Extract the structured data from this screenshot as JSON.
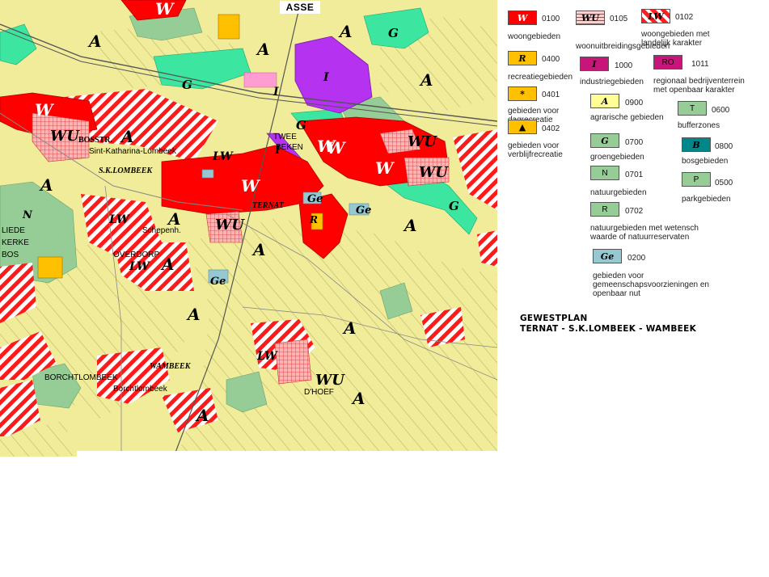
{
  "map": {
    "top_label": "ASSE",
    "zone_letters": [
      "A",
      "A",
      "A",
      "A",
      "A",
      "A",
      "A",
      "A",
      "A",
      "A",
      "A",
      "A",
      "A",
      "A",
      "G",
      "G",
      "G",
      "G",
      "I",
      "I",
      "I",
      "W",
      "W",
      "W",
      "W",
      "W",
      "WU",
      "WU",
      "WU",
      "WU",
      "WU",
      "LW",
      "LW",
      "LW",
      "LW",
      "Ge",
      "Ge",
      "Ge",
      "R",
      "N",
      "W"
    ],
    "place_names": {
      "bosstr": "BOSSTR.",
      "sk_lombeek": "S.K.LOMBEEK",
      "ternat": "TERNAT",
      "twee": "TWEE",
      "beken": "BEKEN",
      "liede": "LIEDE",
      "kerke": "KERKE",
      "bos": "BOS",
      "overdorp": "OVERDORP",
      "wambeek": "WAMBEEK",
      "borchtlombeek": "BORCHTLOMBEEK",
      "dhoef": "D'HOEF",
      "katharina": "Sint-Katharina-Lombeek",
      "schepenh": "Schepenh.",
      "borcht_small": "Borchtlombeek"
    }
  },
  "legend": [
    {
      "swatch": "W",
      "fill": "#ff0000",
      "code": "0100",
      "desc": [
        "woongebieden"
      ],
      "text_color": "#ffffff"
    },
    {
      "swatch": "WU",
      "fill": "#ff9c9c",
      "code": "0105",
      "desc": [
        "woonuitbreidingsgebieden"
      ],
      "hatch": "grid"
    },
    {
      "swatch": "LW",
      "fill": "#ff2020",
      "code": "0102",
      "desc": [
        "woongebieden met",
        "landelijk karakter"
      ],
      "hatch": "diag"
    },
    {
      "swatch": "R",
      "fill": "#ffc000",
      "code": "0400",
      "desc": [
        "recreatiegebieden"
      ]
    },
    {
      "swatch": "I",
      "fill": "#c8157a",
      "code": "1000",
      "desc": [
        "industriegebieden"
      ]
    },
    {
      "swatch": "RO",
      "fill": "#c8157a",
      "code": "1011",
      "desc": [
        "regionaal bedrijventerrein",
        "met openbaar   karakter"
      ]
    },
    {
      "swatch": "*",
      "fill": "#ffc000",
      "code": "0401",
      "desc": [
        "gebieden voor",
        "dagrecreatie"
      ]
    },
    {
      "swatch": "A",
      "fill": "#ffff96",
      "code": "0900",
      "desc": [
        "agrarische gebieden"
      ]
    },
    {
      "swatch": "T",
      "fill": "#96cd96",
      "code": "0600",
      "desc": [
        "bufferzones"
      ]
    },
    {
      "swatch": "▲",
      "fill": "#ffc000",
      "code": "0402",
      "desc": [
        "gebieden voor",
        "verblijfrecreatie"
      ]
    },
    {
      "swatch": "G",
      "fill": "#96cd96",
      "code": "0700",
      "desc": [
        "groengebieden"
      ]
    },
    {
      "swatch": "B",
      "fill": "#00878a",
      "code": "0800",
      "desc": [
        "bosgebieden"
      ]
    },
    {
      "swatch": "N",
      "fill": "#96cd96",
      "code": "0701",
      "desc": [
        "natuurgebieden"
      ]
    },
    {
      "swatch": "P",
      "fill": "#96cd96",
      "code": "0500",
      "desc": [
        "parkgebieden"
      ]
    },
    {
      "swatch": "R",
      "fill": "#96cd96",
      "code": "0702",
      "desc": [
        "natuurgebieden met wetensch",
        "waarde of natuurreservaten"
      ]
    },
    {
      "swatch": "Ge",
      "fill": "#96c8d2",
      "code": "0200",
      "desc": [
        "gebieden voor",
        "gemeenschapsvoorzieningen en",
        "openbaar nut"
      ]
    }
  ],
  "title": {
    "line1": "GEWESTPLAN",
    "line2": "TERNAT - S.K.LOMBEEK - WAMBEEK"
  },
  "colors": {
    "agrarian": "#f0ec9a",
    "agrarian_hatch": "#c9c46e",
    "residential": "#ff0000",
    "green": "#3ce6a0",
    "nature": "#96cd96",
    "industry": "#b432f0",
    "community": "#96c8d2",
    "recreation": "#ffc000"
  }
}
